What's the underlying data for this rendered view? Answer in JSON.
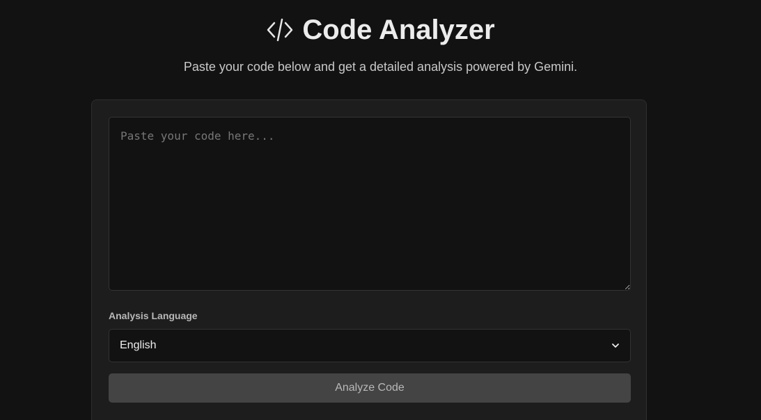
{
  "header": {
    "icon": "code-icon",
    "title": "Code Analyzer",
    "subtitle": "Paste your code below and get a detailed analysis powered by Gemini."
  },
  "form": {
    "code_input": {
      "value": "",
      "placeholder": "Paste your code here..."
    },
    "language": {
      "label": "Analysis Language",
      "selected": "English",
      "icon": "chevron-down-icon"
    },
    "analyze_button_label": "Analyze Code"
  },
  "colors": {
    "background": "#121212",
    "card": "#1d1d1d",
    "button": "#444444"
  }
}
